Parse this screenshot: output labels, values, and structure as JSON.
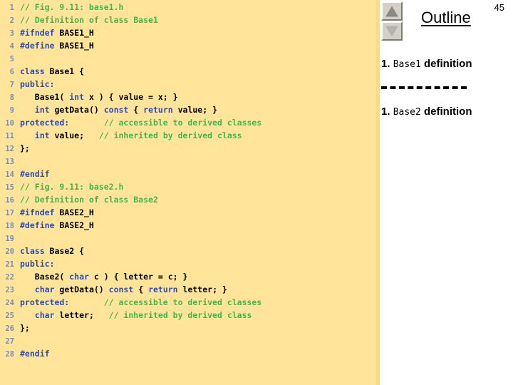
{
  "page_number": "45",
  "code_panel": {
    "lines": [
      {
        "n": "1",
        "tokens": [
          {
            "t": "comment",
            "s": "// Fig. 9.11: base1.h"
          }
        ]
      },
      {
        "n": "2",
        "tokens": [
          {
            "t": "comment",
            "s": "// Definition of class Base1"
          }
        ]
      },
      {
        "n": "3",
        "tokens": [
          {
            "t": "pre",
            "s": "#ifndef"
          },
          {
            "t": "plain",
            "s": " BASE1_H"
          }
        ]
      },
      {
        "n": "4",
        "tokens": [
          {
            "t": "pre",
            "s": "#define"
          },
          {
            "t": "plain",
            "s": " BASE1_H"
          }
        ]
      },
      {
        "n": "5",
        "tokens": []
      },
      {
        "n": "6",
        "tokens": [
          {
            "t": "keyword",
            "s": "class"
          },
          {
            "t": "plain",
            "s": " Base1 {"
          }
        ]
      },
      {
        "n": "7",
        "tokens": [
          {
            "t": "keyword",
            "s": "public:"
          }
        ]
      },
      {
        "n": "8",
        "tokens": [
          {
            "t": "plain",
            "s": "   Base1( "
          },
          {
            "t": "keyword",
            "s": "int"
          },
          {
            "t": "plain",
            "s": " x ) { value = x; }"
          }
        ]
      },
      {
        "n": "9",
        "tokens": [
          {
            "t": "plain",
            "s": "   "
          },
          {
            "t": "keyword",
            "s": "int"
          },
          {
            "t": "plain",
            "s": " getData() "
          },
          {
            "t": "keyword",
            "s": "const"
          },
          {
            "t": "plain",
            "s": " { "
          },
          {
            "t": "keyword",
            "s": "return"
          },
          {
            "t": "plain",
            "s": " value; }"
          }
        ]
      },
      {
        "n": "10",
        "tokens": [
          {
            "t": "keyword",
            "s": "protected:"
          },
          {
            "t": "plain",
            "s": "       "
          },
          {
            "t": "comment",
            "s": "// accessible to derived classes"
          }
        ]
      },
      {
        "n": "11",
        "tokens": [
          {
            "t": "plain",
            "s": "   "
          },
          {
            "t": "keyword",
            "s": "int"
          },
          {
            "t": "plain",
            "s": " value;   "
          },
          {
            "t": "comment",
            "s": "// inherited by derived class"
          }
        ]
      },
      {
        "n": "12",
        "tokens": [
          {
            "t": "plain",
            "s": "};"
          }
        ]
      },
      {
        "n": "13",
        "tokens": []
      },
      {
        "n": "14",
        "tokens": [
          {
            "t": "pre",
            "s": "#endif"
          }
        ]
      },
      {
        "n": "15",
        "tokens": [
          {
            "t": "comment",
            "s": "// Fig. 9.11: base2.h"
          }
        ]
      },
      {
        "n": "16",
        "tokens": [
          {
            "t": "comment",
            "s": "// Definition of class Base2"
          }
        ]
      },
      {
        "n": "17",
        "tokens": [
          {
            "t": "pre",
            "s": "#ifndef"
          },
          {
            "t": "plain",
            "s": " BASE2_H"
          }
        ]
      },
      {
        "n": "18",
        "tokens": [
          {
            "t": "pre",
            "s": "#define"
          },
          {
            "t": "plain",
            "s": " BASE2_H"
          }
        ]
      },
      {
        "n": "19",
        "tokens": []
      },
      {
        "n": "20",
        "tokens": [
          {
            "t": "keyword",
            "s": "class"
          },
          {
            "t": "plain",
            "s": " Base2 {"
          }
        ]
      },
      {
        "n": "21",
        "tokens": [
          {
            "t": "keyword",
            "s": "public:"
          }
        ]
      },
      {
        "n": "22",
        "tokens": [
          {
            "t": "plain",
            "s": "   Base2( "
          },
          {
            "t": "keyword",
            "s": "char"
          },
          {
            "t": "plain",
            "s": " c ) { letter = c; }"
          }
        ]
      },
      {
        "n": "23",
        "tokens": [
          {
            "t": "plain",
            "s": "   "
          },
          {
            "t": "keyword",
            "s": "char"
          },
          {
            "t": "plain",
            "s": " getData() "
          },
          {
            "t": "keyword",
            "s": "const"
          },
          {
            "t": "plain",
            "s": " { "
          },
          {
            "t": "keyword",
            "s": "return"
          },
          {
            "t": "plain",
            "s": " letter; }"
          }
        ]
      },
      {
        "n": "24",
        "tokens": [
          {
            "t": "keyword",
            "s": "protected:"
          },
          {
            "t": "plain",
            "s": "       "
          },
          {
            "t": "comment",
            "s": "// accessible to derived classes"
          }
        ]
      },
      {
        "n": "25",
        "tokens": [
          {
            "t": "plain",
            "s": "   "
          },
          {
            "t": "keyword",
            "s": "char"
          },
          {
            "t": "plain",
            "s": " letter;   "
          },
          {
            "t": "comment",
            "s": "// inherited by derived class"
          }
        ]
      },
      {
        "n": "26",
        "tokens": [
          {
            "t": "plain",
            "s": "};"
          }
        ]
      },
      {
        "n": "27",
        "tokens": []
      },
      {
        "n": "28",
        "tokens": [
          {
            "t": "pre",
            "s": "#endif"
          }
        ]
      }
    ]
  },
  "outline": {
    "title": "Outline",
    "scroll_up_icon": "triangle-up-icon",
    "scroll_down_icon": "triangle-down-icon",
    "items": [
      {
        "number": "1.",
        "code": "Base1",
        "text": "definition"
      },
      {
        "number": "1.",
        "code": "Base2",
        "text": "definition"
      }
    ]
  },
  "colors": {
    "code_background": "#ffe49a",
    "keyword": "#2b4db5",
    "comment": "#43b54a",
    "line_number": "#6f8fc4",
    "plain": "#000000"
  }
}
